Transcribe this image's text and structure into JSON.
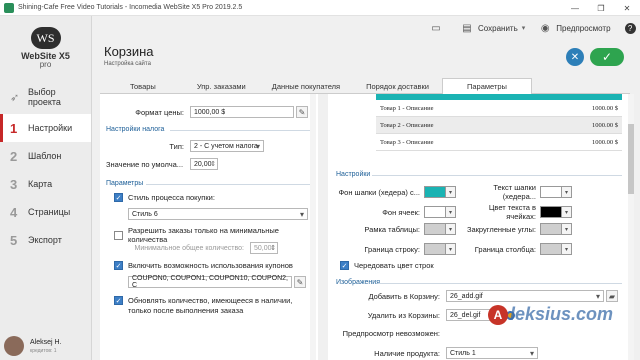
{
  "window": {
    "title": "Shining-Cafe Free Video Tutorials - Incomedia WebSite X5 Pro 2019.2.5",
    "controls": [
      "—",
      "❐",
      "✕"
    ]
  },
  "logo": {
    "mark": "WS",
    "name": "WebSite X5",
    "edition": "pro"
  },
  "sidebar": {
    "items": [
      {
        "num": "",
        "icon": "rocket-icon",
        "label": "Выбор проекта"
      },
      {
        "num": "1",
        "label": "Настройки",
        "active": true
      },
      {
        "num": "2",
        "label": "Шаблон"
      },
      {
        "num": "3",
        "label": "Карта"
      },
      {
        "num": "4",
        "label": "Страницы"
      },
      {
        "num": "5",
        "label": "Экспорт"
      }
    ],
    "user": {
      "name": "Aleksej H.",
      "status": "кредитов: 1"
    }
  },
  "toolbar": {
    "save_label": "Сохранить",
    "preview_label": "Предпросмотр"
  },
  "header": {
    "title": "Корзина",
    "subtitle": "Настройка сайта"
  },
  "tabs": [
    "Товары",
    "Упр. заказами",
    "Данные покупателя",
    "Порядок доставки",
    "Параметры"
  ],
  "active_tab": "Параметры",
  "left": {
    "price_format_label": "Формат цены:",
    "price_format_value": "1000,00 $",
    "tax_section": "Настройки налога",
    "tax_type_label": "Тип:",
    "tax_type_value": "2 - С учетом налога",
    "tax_default_label": "Значение по умолча...",
    "tax_default_value": "20,00",
    "params_section": "Параметры",
    "purchase_style_label": "Стиль процесса покупки:",
    "purchase_style_value": "Стиль 6",
    "min_orders_label": "Разрешить заказы только на минимальные количества",
    "min_total_label": "Минимальное общее количество:",
    "min_total_value": "50,00",
    "coupons_label": "Включить возможность использования купонов",
    "coupons_value": "COUPON0, COUPON1, COUPON10, COUPON2, C",
    "update_qty_label": "Обновлять количество, имеющееся в наличии, только после выполнения заказа"
  },
  "right": {
    "preview_rows": [
      {
        "item": "Товар 1 - Описание",
        "price": "1000.00 $"
      },
      {
        "item": "Товар 2 - Описание",
        "price": "1000.00 $"
      },
      {
        "item": "Товар 3 - Описание",
        "price": "1000.00 $"
      }
    ],
    "settings_section": "Настройки",
    "header_bg_label": "Фон шапки (хедера) с...",
    "header_text_label": "Текст шапки (хедера...",
    "cell_bg_label": "Фон ячеек:",
    "cell_text_label": "Цвет текста в ячейках:",
    "table_border_label": "Рамка таблицы:",
    "rounded_corners_label": "Закругленные углы:",
    "row_border_label": "Граница строку:",
    "col_border_label": "Граница столбца:",
    "alternate_rows_label": "Чередовать цвет строк",
    "images_section": "Изображения",
    "add_to_cart_label": "Добавить в Корзину:",
    "add_to_cart_value": "26_add.gif",
    "remove_from_cart_label": "Удалить из Корзины:",
    "remove_from_cart_value": "26_del.gif",
    "preview_unavailable_label": "Предпросмотр невозможен:",
    "availability_label": "Наличие продукта:",
    "availability_value": "Стиль 1"
  },
  "colors": {
    "header_bg": "#1ab3b3",
    "header_text": "#ffffff",
    "cell_bg": "#ffffff",
    "cell_text": "#000000",
    "table_border": "#cfcfcf",
    "rounded": "#cfcfcf",
    "row_border": "#cfcfcf",
    "col_border": "#cfcfcf"
  },
  "watermark": {
    "badge": "A",
    "text": "leksius.com"
  }
}
